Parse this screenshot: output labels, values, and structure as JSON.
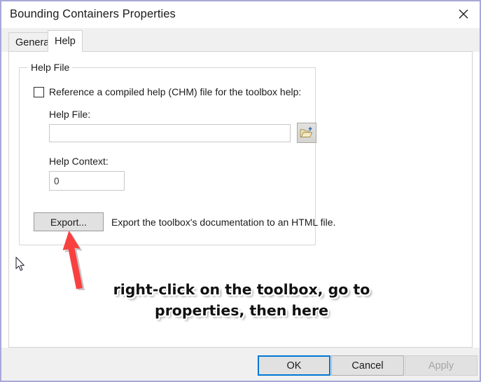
{
  "window": {
    "title": "Bounding Containers Properties",
    "close_icon": "close-icon"
  },
  "tabs": [
    {
      "label": "General",
      "active": false
    },
    {
      "label": "Help",
      "active": true
    }
  ],
  "help_tab": {
    "group_title": "Help File",
    "reference_checkbox": {
      "label": "Reference a compiled help (CHM) file for the toolbox help:",
      "checked": false
    },
    "help_file": {
      "label": "Help File:",
      "value": "",
      "placeholder": "",
      "browse_icon": "open-folder-icon"
    },
    "help_context": {
      "label": "Help Context:",
      "value": "0"
    },
    "export": {
      "button_label": "Export...",
      "description": "Export the toolbox's documentation to an HTML file."
    }
  },
  "footer": {
    "ok_label": "OK",
    "cancel_label": "Cancel",
    "apply_label": "Apply",
    "apply_enabled": false
  },
  "annotation": {
    "line1": "right-click on the toolbox, go to",
    "line2": "properties, then here",
    "arrow_color": "#f94040"
  },
  "colors": {
    "accent": "#0078d7",
    "window_border": "#a8a8d8",
    "chrome": "#f0f0f0",
    "button_face": "#e1e1e1"
  }
}
